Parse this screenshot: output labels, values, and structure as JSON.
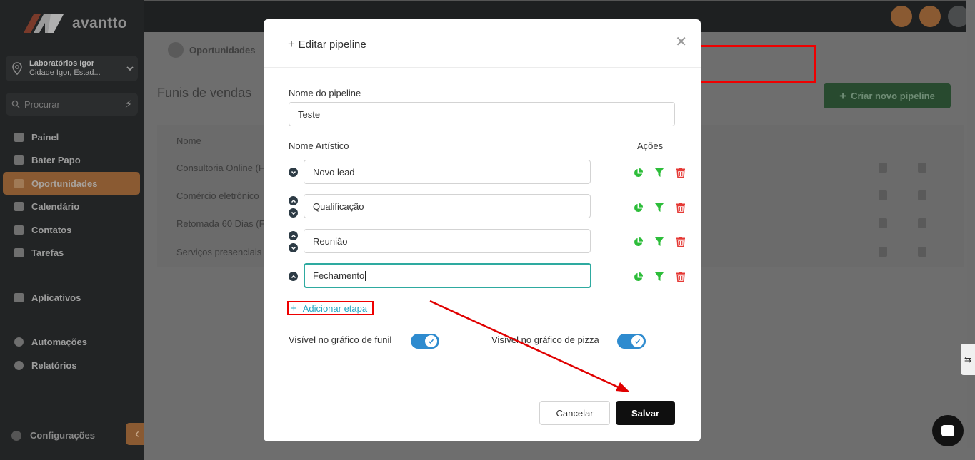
{
  "app": {
    "brand": "avantto",
    "company_name": "Laboratórios Igor",
    "company_location": "Cidade Igor, Estad...",
    "search_placeholder": "Procurar"
  },
  "sidebar": {
    "items": [
      {
        "label": "Painel",
        "icon": "dashboard-icon"
      },
      {
        "label": "Bater Papo",
        "icon": "chat-icon"
      },
      {
        "label": "Oportunidades",
        "icon": "funnel-icon",
        "active": true
      },
      {
        "label": "Calendário",
        "icon": "calendar-icon"
      },
      {
        "label": "Contatos",
        "icon": "person-icon"
      },
      {
        "label": "Tarefas",
        "icon": "checkbox-icon"
      }
    ],
    "apps_label": "Aplicativos",
    "automations_label": "Automações",
    "reports_label": "Relatórios",
    "settings_label": "Configurações"
  },
  "main": {
    "breadcrumb": "Oportunidades",
    "title": "Funis de vendas",
    "create_button": "Criar novo pipeline",
    "table": {
      "header": "Nome",
      "rows": [
        "Consultoria Online (F",
        "Comércio eletrônico",
        "Retomada 60 Dias (F",
        "Serviços presenciais"
      ]
    }
  },
  "modal": {
    "title": "Editar pipeline",
    "pipeline_name_label": "Nome do pipeline",
    "pipeline_name_value": "Teste",
    "stage_name_label": "Nome Artístico",
    "actions_label": "Ações",
    "stages": [
      "Novo lead",
      "Qualificação",
      "Reunião",
      "Fechamento"
    ],
    "add_stage": "Adicionar etapa",
    "funnel_toggle_label": "Visível no gráfico de funil",
    "pie_toggle_label": "Visível no gráfico de pizza",
    "funnel_toggle_on": true,
    "pie_toggle_on": true,
    "cancel": "Cancelar",
    "save": "Salvar"
  },
  "colors": {
    "accent_green": "#2dbd3a",
    "delete_red": "#e53935",
    "toggle_blue": "#2e8bcf",
    "link_blue": "#27a7c4",
    "annotation_red": "#e00000"
  }
}
